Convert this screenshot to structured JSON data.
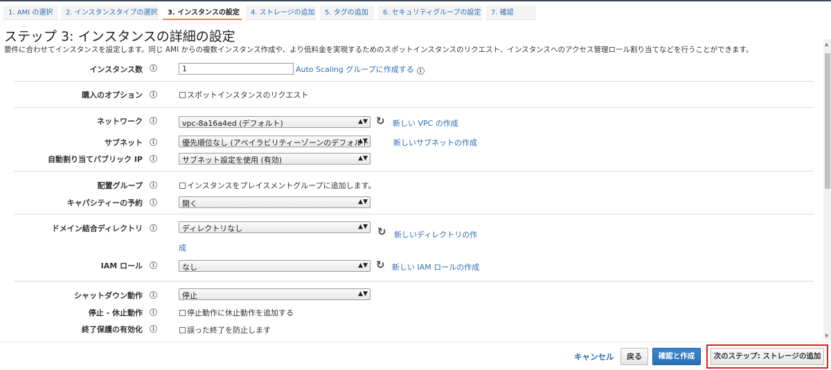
{
  "wizard": {
    "tabs": [
      {
        "label": "1. AMI の選択"
      },
      {
        "label": "2. インスタンスタイプの選択"
      },
      {
        "label": "3. インスタンスの設定"
      },
      {
        "label": "4. ストレージの追加"
      },
      {
        "label": "5. タグの追加"
      },
      {
        "label": "6. セキュリティグループの設定"
      },
      {
        "label": "7. 確認"
      }
    ],
    "active_index": 2
  },
  "page": {
    "title": "ステップ 3: インスタンスの詳細の設定",
    "description": "要件に合わせてインスタンスを設定します。同じ AMI からの複数インスタンス作成や、より低料金を実現するためのスポットインスタンスのリクエスト、インスタンスへのアクセス管理ロール割り当てなどを行うことができます。"
  },
  "form": {
    "instance_count": {
      "label": "インスタンス数",
      "value": "1",
      "link": "Auto Scaling グループに作成する"
    },
    "purchase_option": {
      "label": "購入のオプション",
      "checkbox": "スポットインスタンスのリクエスト"
    },
    "network": {
      "label": "ネットワーク",
      "value": "vpc-8a16a4ed (デフォルト)",
      "link": "新しい VPC の作成"
    },
    "subnet": {
      "label": "サブネット",
      "value": "優先順位なし (アベイラビリティーゾーンのデフォルト)",
      "link": "新しいサブネットの作成"
    },
    "public_ip": {
      "label": "自動割り当てパブリック IP",
      "value": "サブネット設定を使用 (有効)"
    },
    "placement_group": {
      "label": "配置グループ",
      "checkbox": "インスタンスをプレイスメントグループに追加します。"
    },
    "capacity_reservation": {
      "label": "キャパシティーの予約",
      "value": "開く"
    },
    "domain_directory": {
      "label": "ドメイン結合ディレクトリ",
      "value": "ディレクトリなし",
      "link_line1": "新しいディレクトリの作",
      "link_line2": "成"
    },
    "iam_role": {
      "label": "IAM ロール",
      "value": "なし",
      "link": "新しい IAM ロールの作成"
    },
    "shutdown_behavior": {
      "label": "シャットダウン動作",
      "value": "停止"
    },
    "stop_hibernate": {
      "label": "停止 - 休止動作",
      "checkbox": "停止動作に休止動作を追加する"
    },
    "termination_protection": {
      "label": "終了保護の有効化",
      "checkbox": "誤った終了を防止します"
    }
  },
  "footer": {
    "cancel": "キャンセル",
    "back": "戻る",
    "review": "確認と作成",
    "next": "次のステップ: ストレージの追加"
  },
  "colors": {
    "link": "#2d6db5",
    "active_tab_underline": "#e49500",
    "primary_button": "#2a6fb8",
    "highlight_box": "#d62020"
  }
}
